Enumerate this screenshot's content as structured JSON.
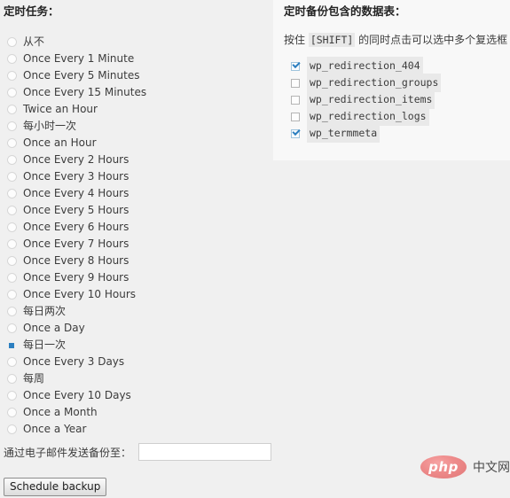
{
  "page": {
    "background_color": "#f0f0f0",
    "text_color": "#3c3c3c",
    "accent_color": "#2c7fc0"
  },
  "schedule": {
    "heading": "定时任务：",
    "options": [
      {
        "label": "从不",
        "selected": false
      },
      {
        "label": "Once Every 1 Minute",
        "selected": false
      },
      {
        "label": "Once Every 5 Minutes",
        "selected": false
      },
      {
        "label": "Once Every 15 Minutes",
        "selected": false
      },
      {
        "label": "Twice an Hour",
        "selected": false
      },
      {
        "label": "每小时一次",
        "selected": false
      },
      {
        "label": "Once an Hour",
        "selected": false
      },
      {
        "label": "Once Every 2 Hours",
        "selected": false
      },
      {
        "label": "Once Every 3 Hours",
        "selected": false
      },
      {
        "label": "Once Every 4 Hours",
        "selected": false
      },
      {
        "label": "Once Every 5 Hours",
        "selected": false
      },
      {
        "label": "Once Every 6 Hours",
        "selected": false
      },
      {
        "label": "Once Every 7 Hours",
        "selected": false
      },
      {
        "label": "Once Every 8 Hours",
        "selected": false
      },
      {
        "label": "Once Every 9 Hours",
        "selected": false
      },
      {
        "label": "Once Every 10 Hours",
        "selected": false
      },
      {
        "label": "每日两次",
        "selected": false
      },
      {
        "label": "Once a Day",
        "selected": false
      },
      {
        "label": "每日一次",
        "selected": true
      },
      {
        "label": "Once Every 3 Days",
        "selected": false
      },
      {
        "label": "每周",
        "selected": false
      },
      {
        "label": "Once Every 10 Days",
        "selected": false
      },
      {
        "label": "Once a Month",
        "selected": false
      },
      {
        "label": "Once a Year",
        "selected": false
      }
    ]
  },
  "email": {
    "label": "通过电子邮件发送备份至：",
    "value": "",
    "placeholder": ""
  },
  "submit": {
    "label": "Schedule backup"
  },
  "tables_panel": {
    "heading": "定时备份包含的数据表：",
    "hint_prefix": "按住 ",
    "hint_key": "[SHIFT]",
    "hint_suffix": " 的同时点击可以选中多个复选框",
    "background_color": "#f8f8f8",
    "tables": [
      {
        "name": "wp_redirection_404",
        "checked": true
      },
      {
        "name": "wp_redirection_groups",
        "checked": false
      },
      {
        "name": "wp_redirection_items",
        "checked": false
      },
      {
        "name": "wp_redirection_logs",
        "checked": false
      },
      {
        "name": "wp_termmeta",
        "checked": true
      }
    ]
  },
  "watermark": {
    "badge_text": "php",
    "suffix_text": "中文网",
    "badge_color": "#ee8b8b"
  }
}
